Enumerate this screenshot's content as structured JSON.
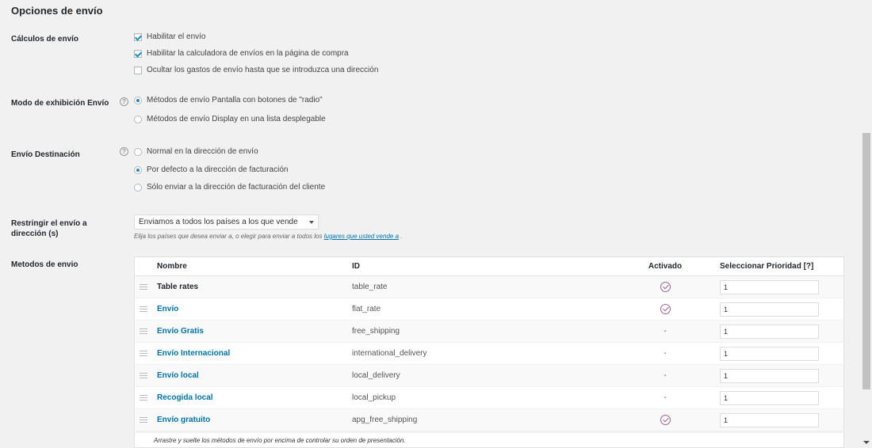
{
  "section_title": "Opciones de envío",
  "shipping_calculations": {
    "label": "Cálculos de envío",
    "options": [
      {
        "label": "Habilitar el envío",
        "checked": true
      },
      {
        "label": "Habilitar la calculadora de envíos en la página de compra",
        "checked": true
      },
      {
        "label": "Ocultar los gastos de envío hasta que se introduzca una dirección",
        "checked": false
      }
    ]
  },
  "display_mode": {
    "label": "Modo de exhibición Envío",
    "help": "?",
    "options": [
      {
        "label": "Métodos de envío Pantalla con botones de \"radio\"",
        "checked": true
      },
      {
        "label": "Métodos de envío Display en una lista desplegable",
        "checked": false
      }
    ]
  },
  "destination": {
    "label": "Envío Destinación",
    "help": "?",
    "options": [
      {
        "label": "Normal en la dirección de envío",
        "checked": false
      },
      {
        "label": "Por defecto a la dirección de facturación",
        "checked": true
      },
      {
        "label": "Sólo enviar a la dirección de facturación del cliente",
        "checked": false
      }
    ]
  },
  "restrict": {
    "label_line1": "Restringir el envío a",
    "label_line2": "dirección (s)",
    "selected": "Enviamos a todos los países a los que vende",
    "desc_prefix": "Elija los países que desea enviar a, o elegir para enviar a todos los",
    "desc_link": "lugares que usted vende a",
    "desc_suffix": "."
  },
  "methods": {
    "label": "Metodos de envio",
    "headers": {
      "name": "Nombre",
      "id": "ID",
      "enabled": "Activado",
      "priority": "Seleccionar Prioridad [?]"
    },
    "rows": [
      {
        "name": "Table rates",
        "id": "table_rate",
        "enabled": true,
        "disabled_mark": "",
        "priority": "1",
        "link": false
      },
      {
        "name": "Envío",
        "id": "flat_rate",
        "enabled": true,
        "disabled_mark": "",
        "priority": "1",
        "link": true
      },
      {
        "name": "Envío Gratis",
        "id": "free_shipping",
        "enabled": false,
        "disabled_mark": "-",
        "priority": "1",
        "link": true
      },
      {
        "name": "Envío Internacional",
        "id": "international_delivery",
        "enabled": false,
        "disabled_mark": "-",
        "priority": "1",
        "link": true
      },
      {
        "name": "Envío local",
        "id": "local_delivery",
        "enabled": false,
        "disabled_mark": "-",
        "priority": "1",
        "link": true
      },
      {
        "name": "Recogida local",
        "id": "local_pickup",
        "enabled": false,
        "disabled_mark": "-",
        "priority": "1",
        "link": true
      },
      {
        "name": "Envío gratuito",
        "id": "apg_free_shipping",
        "enabled": true,
        "disabled_mark": "",
        "priority": "1",
        "link": true
      }
    ],
    "footer_note": "Arrastre y suelte los métodos de envío por encima de controlar su orden de presentación."
  },
  "colors": {
    "link": "#0073aa",
    "check": "#1e8cbe",
    "enabled_icon": "#a46497",
    "background": "#f1f1f1"
  }
}
